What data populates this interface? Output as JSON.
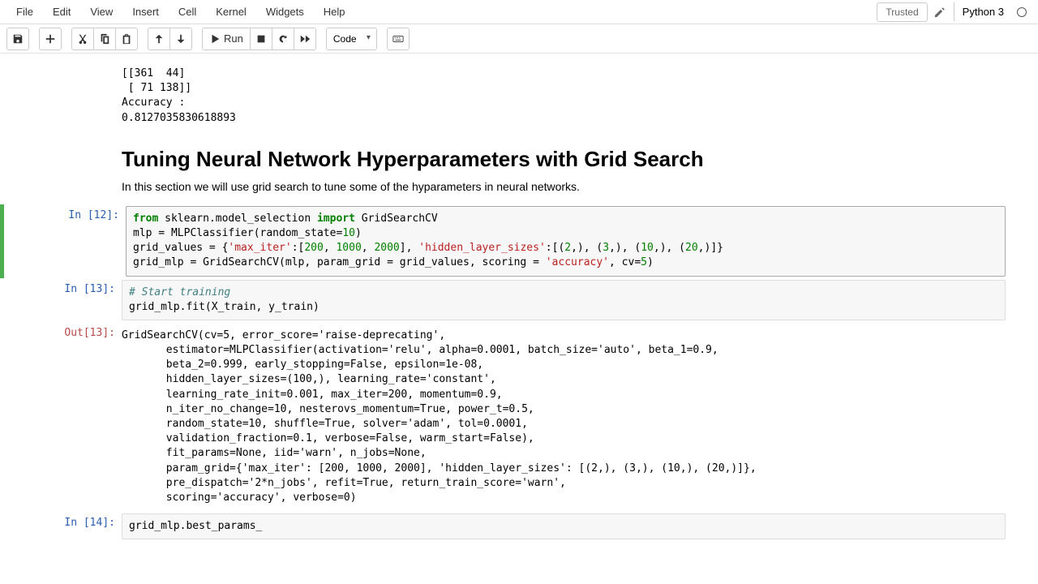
{
  "menubar": {
    "items": [
      "File",
      "Edit",
      "View",
      "Insert",
      "Cell",
      "Kernel",
      "Widgets",
      "Help"
    ],
    "trusted": "Trusted",
    "kernel": "Python 3"
  },
  "toolbar": {
    "run_label": "Run",
    "celltype": "Code"
  },
  "cells": {
    "output_top": "[[361  44]\n [ 71 138]]\nAccuracy :\n0.8127035830618893",
    "md_heading": "Tuning Neural Network Hyperparameters with Grid Search",
    "md_text": "In this section we will use grid search to tune some of the hyparameters in neural networks.",
    "in12_prompt": "In [12]:",
    "in13_prompt": "In [13]:",
    "out13_prompt": "Out[13]:",
    "in14_prompt": "In [14]:",
    "in12_kw_from": "from",
    "in12_mod": " sklearn.model_selection ",
    "in12_kw_import": "import",
    "in12_gs": " GridSearchCV",
    "in12_l2a": "mlp = MLPClassifier(random_state=",
    "in12_l2b": "10",
    "in12_l2c": ")",
    "in12_l3a": "grid_values = {",
    "in12_l3b": "'max_iter'",
    "in12_l3c": ":[",
    "in12_l3d": "200",
    "in12_l3e": ", ",
    "in12_l3f": "1000",
    "in12_l3g": ", ",
    "in12_l3h": "2000",
    "in12_l3i": "], ",
    "in12_l3j": "'hidden_layer_sizes'",
    "in12_l3k": ":[(",
    "in12_l3l": "2",
    "in12_l3m": ",), (",
    "in12_l3n": "3",
    "in12_l3o": ",), (",
    "in12_l3p": "10",
    "in12_l3q": ",), (",
    "in12_l3r": "20",
    "in12_l3s": ",)]}",
    "in12_l4a": "grid_mlp = GridSearchCV(mlp, param_grid = grid_values, scoring = ",
    "in12_l4b": "'accuracy'",
    "in12_l4c": ", cv=",
    "in12_l4d": "5",
    "in12_l4e": ")",
    "in13_cmt": "# Start training",
    "in13_code": "grid_mlp.fit(X_train, y_train)",
    "out13_text": "GridSearchCV(cv=5, error_score='raise-deprecating',\n       estimator=MLPClassifier(activation='relu', alpha=0.0001, batch_size='auto', beta_1=0.9,\n       beta_2=0.999, early_stopping=False, epsilon=1e-08,\n       hidden_layer_sizes=(100,), learning_rate='constant',\n       learning_rate_init=0.001, max_iter=200, momentum=0.9,\n       n_iter_no_change=10, nesterovs_momentum=True, power_t=0.5,\n       random_state=10, shuffle=True, solver='adam', tol=0.0001,\n       validation_fraction=0.1, verbose=False, warm_start=False),\n       fit_params=None, iid='warn', n_jobs=None,\n       param_grid={'max_iter': [200, 1000, 2000], 'hidden_layer_sizes': [(2,), (3,), (10,), (20,)]},\n       pre_dispatch='2*n_jobs', refit=True, return_train_score='warn',\n       scoring='accuracy', verbose=0)",
    "in14_code": "grid_mlp.best_params_"
  }
}
